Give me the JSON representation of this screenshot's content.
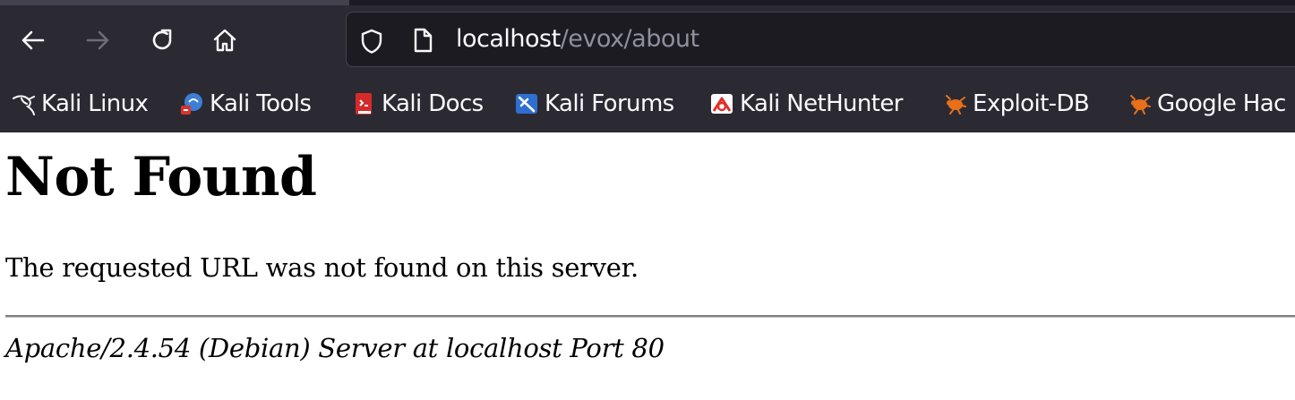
{
  "browser": {
    "url_host": "localhost",
    "url_path": "/evox/about",
    "nav_icons": [
      "back-arrow-icon",
      "forward-arrow-icon",
      "reload-icon",
      "home-icon"
    ],
    "bookmarks": [
      {
        "label": "Kali Linux",
        "icon": "kali-dragon-icon"
      },
      {
        "label": "Kali Tools",
        "icon": "kali-tools-icon"
      },
      {
        "label": "Kali Docs",
        "icon": "kali-docs-icon"
      },
      {
        "label": "Kali Forums",
        "icon": "kali-forums-icon"
      },
      {
        "label": "Kali NetHunter",
        "icon": "kali-nethunter-icon"
      },
      {
        "label": "Exploit-DB",
        "icon": "exploit-db-icon"
      },
      {
        "label": "Google Hac",
        "icon": "exploit-db-icon"
      }
    ]
  },
  "page": {
    "title": "Not Found",
    "message": "The requested URL was not found on this server.",
    "server_signature": "Apache/2.4.54 (Debian) Server at localhost Port 80"
  },
  "colors": {
    "chrome_bg": "#2b2a33",
    "urlbar_bg": "#1c1b22",
    "text_light": "#fbfbfe",
    "url_path_gray": "#8f8f9d",
    "exploit_orange": "#e8701a"
  }
}
